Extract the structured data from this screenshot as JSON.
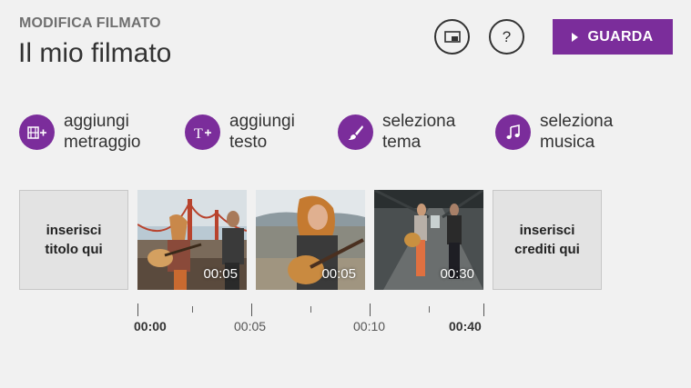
{
  "header": {
    "section": "MODIFICA FILMATO",
    "title": "Il mio filmato",
    "cast_icon": "cast-screen-icon",
    "help_label": "?",
    "watch_label": "GUARDA"
  },
  "actions": [
    {
      "icon": "add-footage-icon",
      "line1": "aggiungi",
      "line2": "metraggio"
    },
    {
      "icon": "add-text-icon",
      "line1": "aggiungi",
      "line2": "testo"
    },
    {
      "icon": "brush-theme-icon",
      "line1": "seleziona",
      "line2": "tema"
    },
    {
      "icon": "music-note-icon",
      "line1": "seleziona",
      "line2": "musica"
    }
  ],
  "storyboard": {
    "title_tile": {
      "line1": "inserisci",
      "line2": "titolo qui"
    },
    "clips": [
      {
        "duration": "00:05"
      },
      {
        "duration": "00:05"
      },
      {
        "duration": "00:30"
      }
    ],
    "credits_tile": {
      "line1": "inserisci",
      "line2": "crediti qui"
    }
  },
  "timeline": {
    "labels": [
      "00:00",
      "00:05",
      "00:10",
      "00:40"
    ]
  },
  "colors": {
    "accent": "#7b2d9b",
    "background": "#f1f1f1"
  }
}
